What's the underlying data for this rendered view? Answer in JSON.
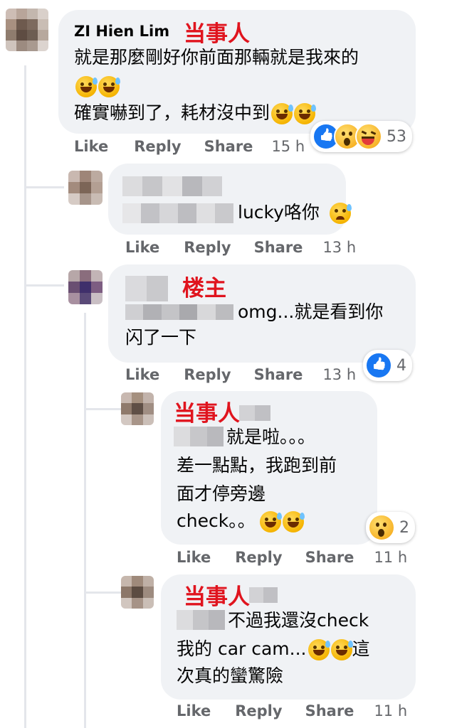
{
  "thread": {
    "comments": [
      {
        "author": "ZI Hien Lim",
        "tag": "当事人",
        "lines": [
          "就是那麼剛好你前面那輛就是我來的",
          "確實嚇到了，耗材沒中到"
        ],
        "reaction_count": "53",
        "reaction_icons": [
          "like-icon",
          "wow-icon",
          "haha-icon"
        ],
        "actions": {
          "like": "Like",
          "reply": "Reply",
          "share": "Share",
          "time": "15 h"
        }
      },
      {
        "author": "",
        "tag": "",
        "lines": [
          "lucky咯你"
        ],
        "actions": {
          "like": "Like",
          "reply": "Reply",
          "share": "Share",
          "time": "13 h"
        }
      },
      {
        "author": "",
        "tag": "楼主",
        "lines": [
          "omg...就是看到你",
          "闪了一下"
        ],
        "reaction_count": "4",
        "reaction_icons": [
          "like-icon"
        ],
        "actions": {
          "like": "Like",
          "reply": "Reply",
          "share": "Share",
          "time": "13 h"
        }
      },
      {
        "author": "",
        "tag": "当事人",
        "lines": [
          "就是啦。。。",
          "差一點點，我跑到前",
          "面才停旁邊",
          "check。。"
        ],
        "reaction_count": "2",
        "reaction_icons": [
          "wow-icon"
        ],
        "actions": {
          "like": "Like",
          "reply": "Reply",
          "share": "Share",
          "time": "11 h"
        }
      },
      {
        "author": "",
        "tag": "当事人",
        "lines": [
          "不過我還沒check",
          "我的 car cam...",
          "這",
          "次真的蠻驚險"
        ],
        "actions": {
          "like": "Like",
          "reply": "Reply",
          "share": "Share",
          "time": "11 h"
        }
      }
    ]
  },
  "colors": {
    "bubble": "#f0f2f5",
    "tag_red": "#e0141e",
    "meta": "#65676b",
    "like_blue": "#1877f2"
  }
}
